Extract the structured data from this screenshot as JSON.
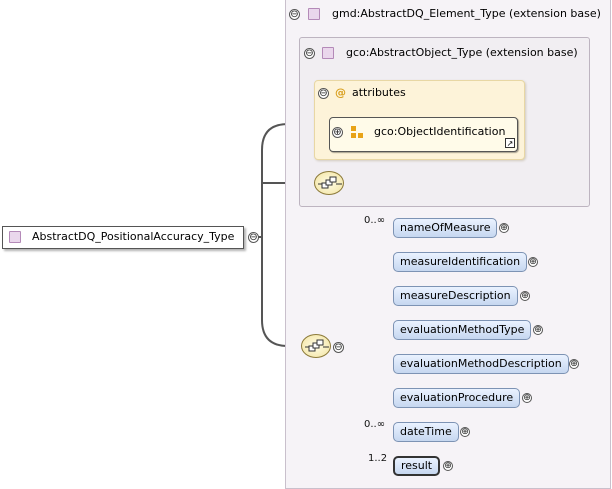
{
  "root": {
    "label": "AbstractDQ_PositionalAccuracy_Type",
    "toggle": "⊖"
  },
  "extension_outer": {
    "label": "gmd:AbstractDQ_Element_Type (extension base)",
    "toggle": "⊖"
  },
  "extension_inner": {
    "label": "gco:AbstractObject_Type (extension base)",
    "toggle": "⊖"
  },
  "attributes": {
    "label": "attributes",
    "at_symbol": "@",
    "toggle": "⊖"
  },
  "attribute_group": {
    "label": "gco:ObjectIdentification",
    "toggle": "⊕"
  },
  "sequence": {
    "toggle": "⊖"
  },
  "elements": [
    {
      "label": "nameOfMeasure",
      "cardinality": "0..∞"
    },
    {
      "label": "measureIdentification",
      "cardinality": ""
    },
    {
      "label": "measureDescription",
      "cardinality": ""
    },
    {
      "label": "evaluationMethodType",
      "cardinality": ""
    },
    {
      "label": "evaluationMethodDescription",
      "cardinality": ""
    },
    {
      "label": "evaluationProcedure",
      "cardinality": ""
    },
    {
      "label": "dateTime",
      "cardinality": "0..∞"
    },
    {
      "label": "result",
      "cardinality": "1..2"
    }
  ],
  "expand_symbol": "⊕",
  "colors": {
    "element_fill": "#c6d7f0",
    "attribute_fill": "#fdf3d9",
    "extension_fill": "#f6f3f7",
    "type_square": "#ead7ec"
  }
}
